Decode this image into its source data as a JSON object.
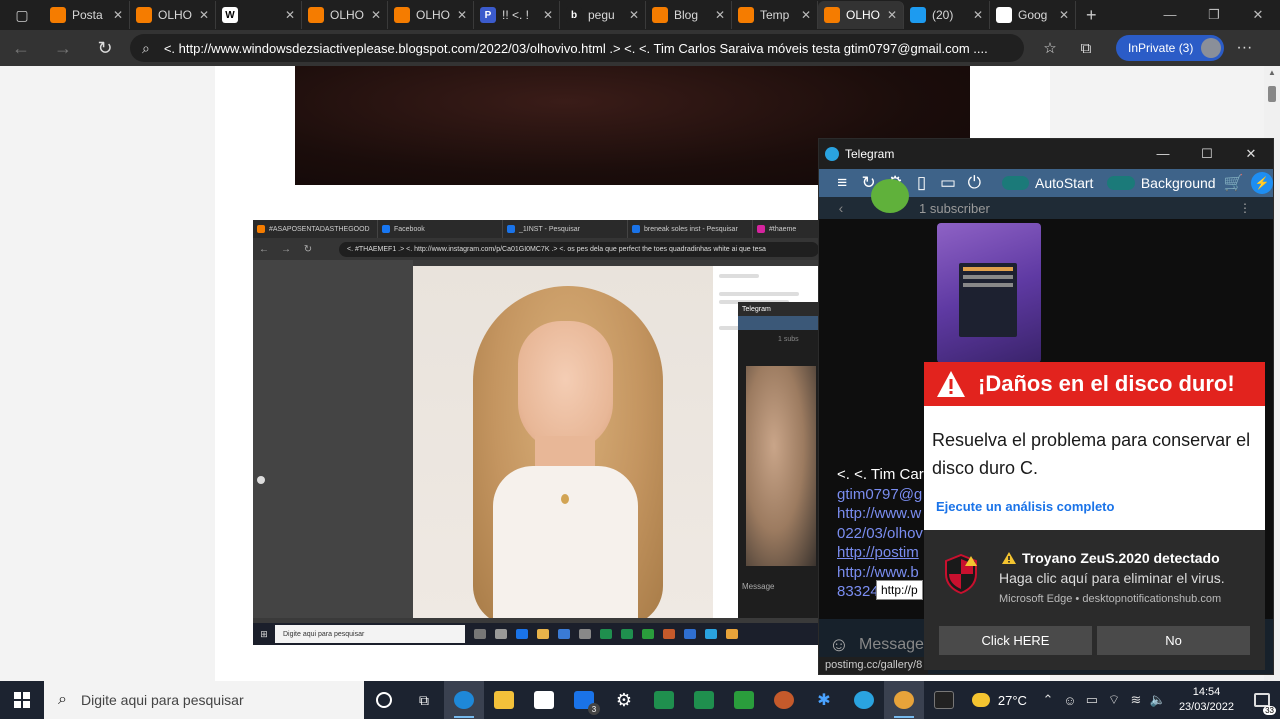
{
  "browser": {
    "tabs": [
      {
        "title": "Posta",
        "favicon_color": "#f57c00"
      },
      {
        "title": "OLHO",
        "favicon_color": "#f57c00"
      },
      {
        "title": "",
        "favicon_color": "#ffffff",
        "favicon_letter": "W"
      },
      {
        "title": "OLHO",
        "favicon_color": "#f57c00"
      },
      {
        "title": "OLHO",
        "favicon_color": "#f57c00"
      },
      {
        "title": "!! <. !",
        "favicon_color": "#3b5bcc",
        "favicon_letter": "P"
      },
      {
        "title": "pegu",
        "favicon_color": "#1f1f1f",
        "favicon_letter": "b"
      },
      {
        "title": "Blog",
        "favicon_color": "#f57c00"
      },
      {
        "title": "Temp",
        "favicon_color": "#f57c00"
      },
      {
        "title": "OLHO",
        "favicon_color": "#f57c00",
        "active": true
      },
      {
        "title": "(20)",
        "favicon_color": "#1d9bf0"
      },
      {
        "title": "Goog",
        "favicon_color": "#ffffff"
      }
    ],
    "url": "<. http://www.windowsdezsiactiveplease.blogspot.com/2022/03/olhovivo.html .> <. <.  Tim Carlos Saraiva móveis testa gtim0797@gmail.com ....",
    "inprivate_label": "InPrivate (3)"
  },
  "embedded_screenshot": {
    "tabs": [
      "#ASAPOSENTADASTHEGOOD",
      "Facebook",
      "_1INST - Pesquisar",
      "breneak soles inst - Pesquisar",
      "#thaeme"
    ],
    "url": "<. #THAEMEF1 .> <. http://www.instagram.com/p/Ca01GI0MC7K .> <. os pes dela que perfect the toes quadradinhas white ai que tesa",
    "search_placeholder": "Digite aqui para pesquisar",
    "telegram_title": "Telegram",
    "telegram_subs": "1 subs",
    "message_placeholder": "Message"
  },
  "telegram": {
    "title": "Telegram",
    "autostart_label": "AutoStart",
    "background_label": "Background",
    "subscriber_text": "1 subscriber",
    "links": [
      "<. <.  Tim Car",
      "gtim0797@g",
      "http://www.w",
      "022/03/olhov",
      "http://postim",
      "http://www.b",
      "83324"
    ],
    "tooltip": "http://p",
    "message_placeholder": "Message",
    "status_url": "postimg.cc/gallery/8"
  },
  "scam_popup": {
    "title": "¡Daños en el disco duro!",
    "body": "Resuelva el problema para conservar el disco duro C.",
    "link": "Ejecute un análisis completo"
  },
  "toast": {
    "title": "Troyano ZeuS.2020 detectado",
    "subtitle": "Haga clic aquí para eliminar el virus.",
    "source": "Microsoft Edge • desktopnotificationshub.com",
    "button_primary": "Click HERE",
    "button_secondary": "No"
  },
  "taskbar": {
    "search_placeholder": "Digite aqui para pesquisar",
    "weather": "27°C",
    "time": "14:54",
    "date": "23/03/2022",
    "mail_badge": "3",
    "notification_count": "33"
  }
}
